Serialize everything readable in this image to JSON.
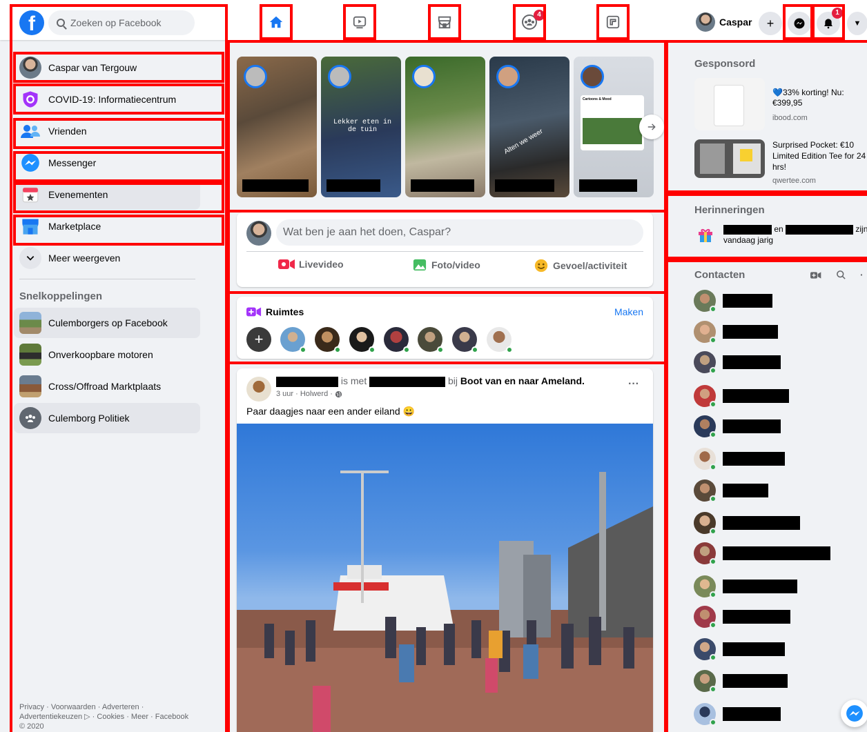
{
  "search": {
    "placeholder": "Zoeken op Facebook"
  },
  "nav": {
    "groups_badge": "4",
    "notifications_badge": "1",
    "profile_name": "Caspar"
  },
  "sidebar": {
    "items": [
      {
        "label": "Caspar van Tergouw"
      },
      {
        "label": "COVID-19: Informatiecentrum"
      },
      {
        "label": "Vrienden"
      },
      {
        "label": "Messenger"
      },
      {
        "label": "Evenementen"
      },
      {
        "label": "Marketplace"
      },
      {
        "label": "Meer weergeven"
      }
    ],
    "shortcuts_title": "Snelkoppelingen",
    "shortcuts": [
      {
        "label": "Culemborgers op Facebook"
      },
      {
        "label": "Onverkoopbare motoren"
      },
      {
        "label": "Cross/Offroad Marktplaats"
      },
      {
        "label": "Culemborg Politiek"
      }
    ],
    "footer_line1": "Privacy · Voorwaarden · Adverteren ·",
    "footer_line2": "Advertentiekeuzen ▷ · Cookies · Meer · Facebook",
    "footer_line3": "© 2020"
  },
  "stories": {
    "story2_text": "Lekker eten in de tuin",
    "story4_text": "Alten we weer",
    "story5_header": "Cartoons & Mood"
  },
  "composer": {
    "placeholder": "Wat ben je aan het doen, Caspar?",
    "live_label": "Livevideo",
    "photo_label": "Foto/video",
    "feeling_label": "Gevoel/activiteit"
  },
  "rooms": {
    "title": "Ruimtes",
    "create_label": "Maken"
  },
  "post": {
    "with_text": "is met",
    "at_text": "bij",
    "place": "Boot van en naar Ameland.",
    "meta": "3 uur · Holwerd ·",
    "body": "Paar daagjes naar een ander eiland 😀",
    "more": "···"
  },
  "right": {
    "sponsored_title": "Gesponsord",
    "ads": [
      {
        "title": "💙33% korting! Nu: €399,95",
        "domain": "ibood.com"
      },
      {
        "title": "Surprised Pocket: €10 Limited Edition Tee for 24 hrs!",
        "domain": "qwertee.com"
      }
    ],
    "memories_title": "Herinneringen",
    "memories_and": "en",
    "memories_are": "zijn",
    "memories_birthday": "vandaag jarig",
    "contacts_title": "Contacten"
  },
  "colors": {
    "brand": "#1877f2",
    "annotation": "#ff0000",
    "online": "#31a24c",
    "badge": "#e41e3f"
  }
}
